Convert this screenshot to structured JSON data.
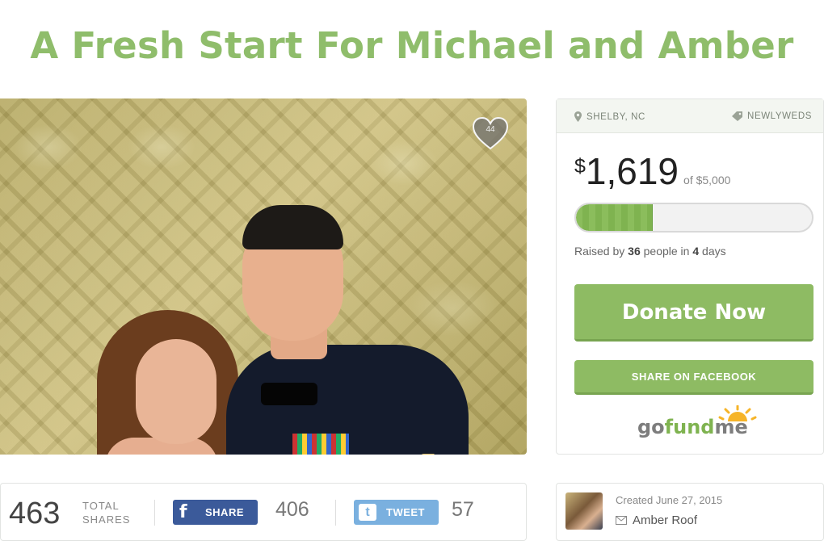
{
  "campaign": {
    "title": "A Fresh Start For Michael and Amber",
    "heart_count": "44"
  },
  "card": {
    "location": "SHELBY, NC",
    "category": "NEWLYWEDS",
    "currency_symbol": "$",
    "raised_amount": "1,619",
    "goal_text": "of $5,000",
    "progress_fraction": 0.324,
    "raised_by_prefix": "Raised by",
    "people_count": "36",
    "people_in": "people in",
    "days_count": "4",
    "days_label": "days",
    "donate_label": "Donate Now",
    "facebook_label": "SHARE ON FACEBOOK",
    "brand": {
      "part1": "go",
      "part2": "fund",
      "part3": "me"
    }
  },
  "shares": {
    "total": "463",
    "total_label_line1": "TOTAL",
    "total_label_line2": "SHARES",
    "facebook_label": "SHARE",
    "facebook_count": "406",
    "twitter_label": "TWEET",
    "twitter_count": "57"
  },
  "creator": {
    "created": "Created June 27, 2015",
    "name": "Amber Roof"
  },
  "colors": {
    "accent_green": "#8ebb63",
    "title_green": "#8fbd6b",
    "facebook_blue": "#3b5a9a",
    "twitter_blue": "#7ab0df"
  },
  "icons": [
    "map-pin-icon",
    "tag-icon",
    "heart-icon",
    "facebook-icon",
    "twitter-icon",
    "envelope-icon",
    "gofundme-sun-icon"
  ]
}
